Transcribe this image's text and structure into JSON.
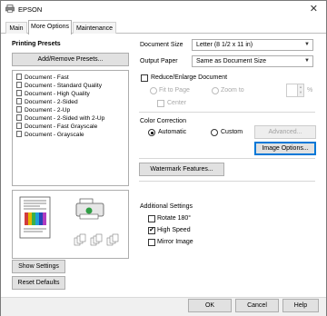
{
  "window": {
    "title": "EPSON"
  },
  "tabs": [
    {
      "label": "Main"
    },
    {
      "label": "More Options"
    },
    {
      "label": "Maintenance"
    }
  ],
  "presets": {
    "heading": "Printing Presets",
    "add_remove_label": "Add/Remove Presets...",
    "items": [
      "Document - Fast",
      "Document - Standard Quality",
      "Document - High Quality",
      "Document - 2-Sided",
      "Document - 2-Up",
      "Document - 2-Sided with 2-Up",
      "Document - Fast Grayscale",
      "Document - Grayscale"
    ],
    "show_settings_label": "Show Settings",
    "reset_defaults_label": "Reset Defaults"
  },
  "document_size": {
    "label": "Document Size",
    "value": "Letter (8 1/2 x 11 in)"
  },
  "output_paper": {
    "label": "Output Paper",
    "value": "Same as Document Size"
  },
  "reduce_enlarge": {
    "label": "Reduce/Enlarge Document",
    "checked": false,
    "fit_to_page_label": "Fit to Page",
    "zoom_to_label": "Zoom to",
    "center_label": "Center",
    "percent_symbol": "%"
  },
  "color_correction": {
    "heading": "Color Correction",
    "automatic_label": "Automatic",
    "custom_label": "Custom",
    "selected": "Automatic",
    "advanced_label": "Advanced...",
    "image_options_label": "Image Options..."
  },
  "watermark_label": "Watermark Features...",
  "additional_settings": {
    "heading": "Additional Settings",
    "rotate_label": "Rotate 180°",
    "rotate_checked": false,
    "high_speed_label": "High Speed",
    "high_speed_checked": true,
    "mirror_label": "Mirror Image",
    "mirror_checked": false
  },
  "footer": {
    "ok_label": "OK",
    "cancel_label": "Cancel",
    "help_label": "Help"
  },
  "colors": {
    "accent": "#0078d7",
    "check_mark": "✔"
  }
}
